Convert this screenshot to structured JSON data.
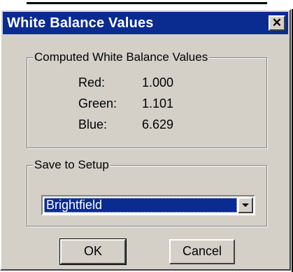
{
  "window": {
    "title": "White Balance Values",
    "close_glyph": "✕"
  },
  "computed": {
    "legend": "Computed White Balance Values",
    "rows": [
      {
        "label": "Red:",
        "value": "1.000"
      },
      {
        "label": "Green:",
        "value": "1.101"
      },
      {
        "label": "Blue:",
        "value": "6.629"
      }
    ]
  },
  "save": {
    "legend": "Save to Setup",
    "selected": "Brightfield"
  },
  "buttons": {
    "ok_label": "OK",
    "cancel_label": "Cancel"
  },
  "colors": {
    "titlebar": "#0a2b8f",
    "face": "#d4d0c8",
    "selection": "#0a2b8f"
  },
  "icons": {
    "close": "close-icon",
    "dropdown": "chevron-down-icon"
  }
}
